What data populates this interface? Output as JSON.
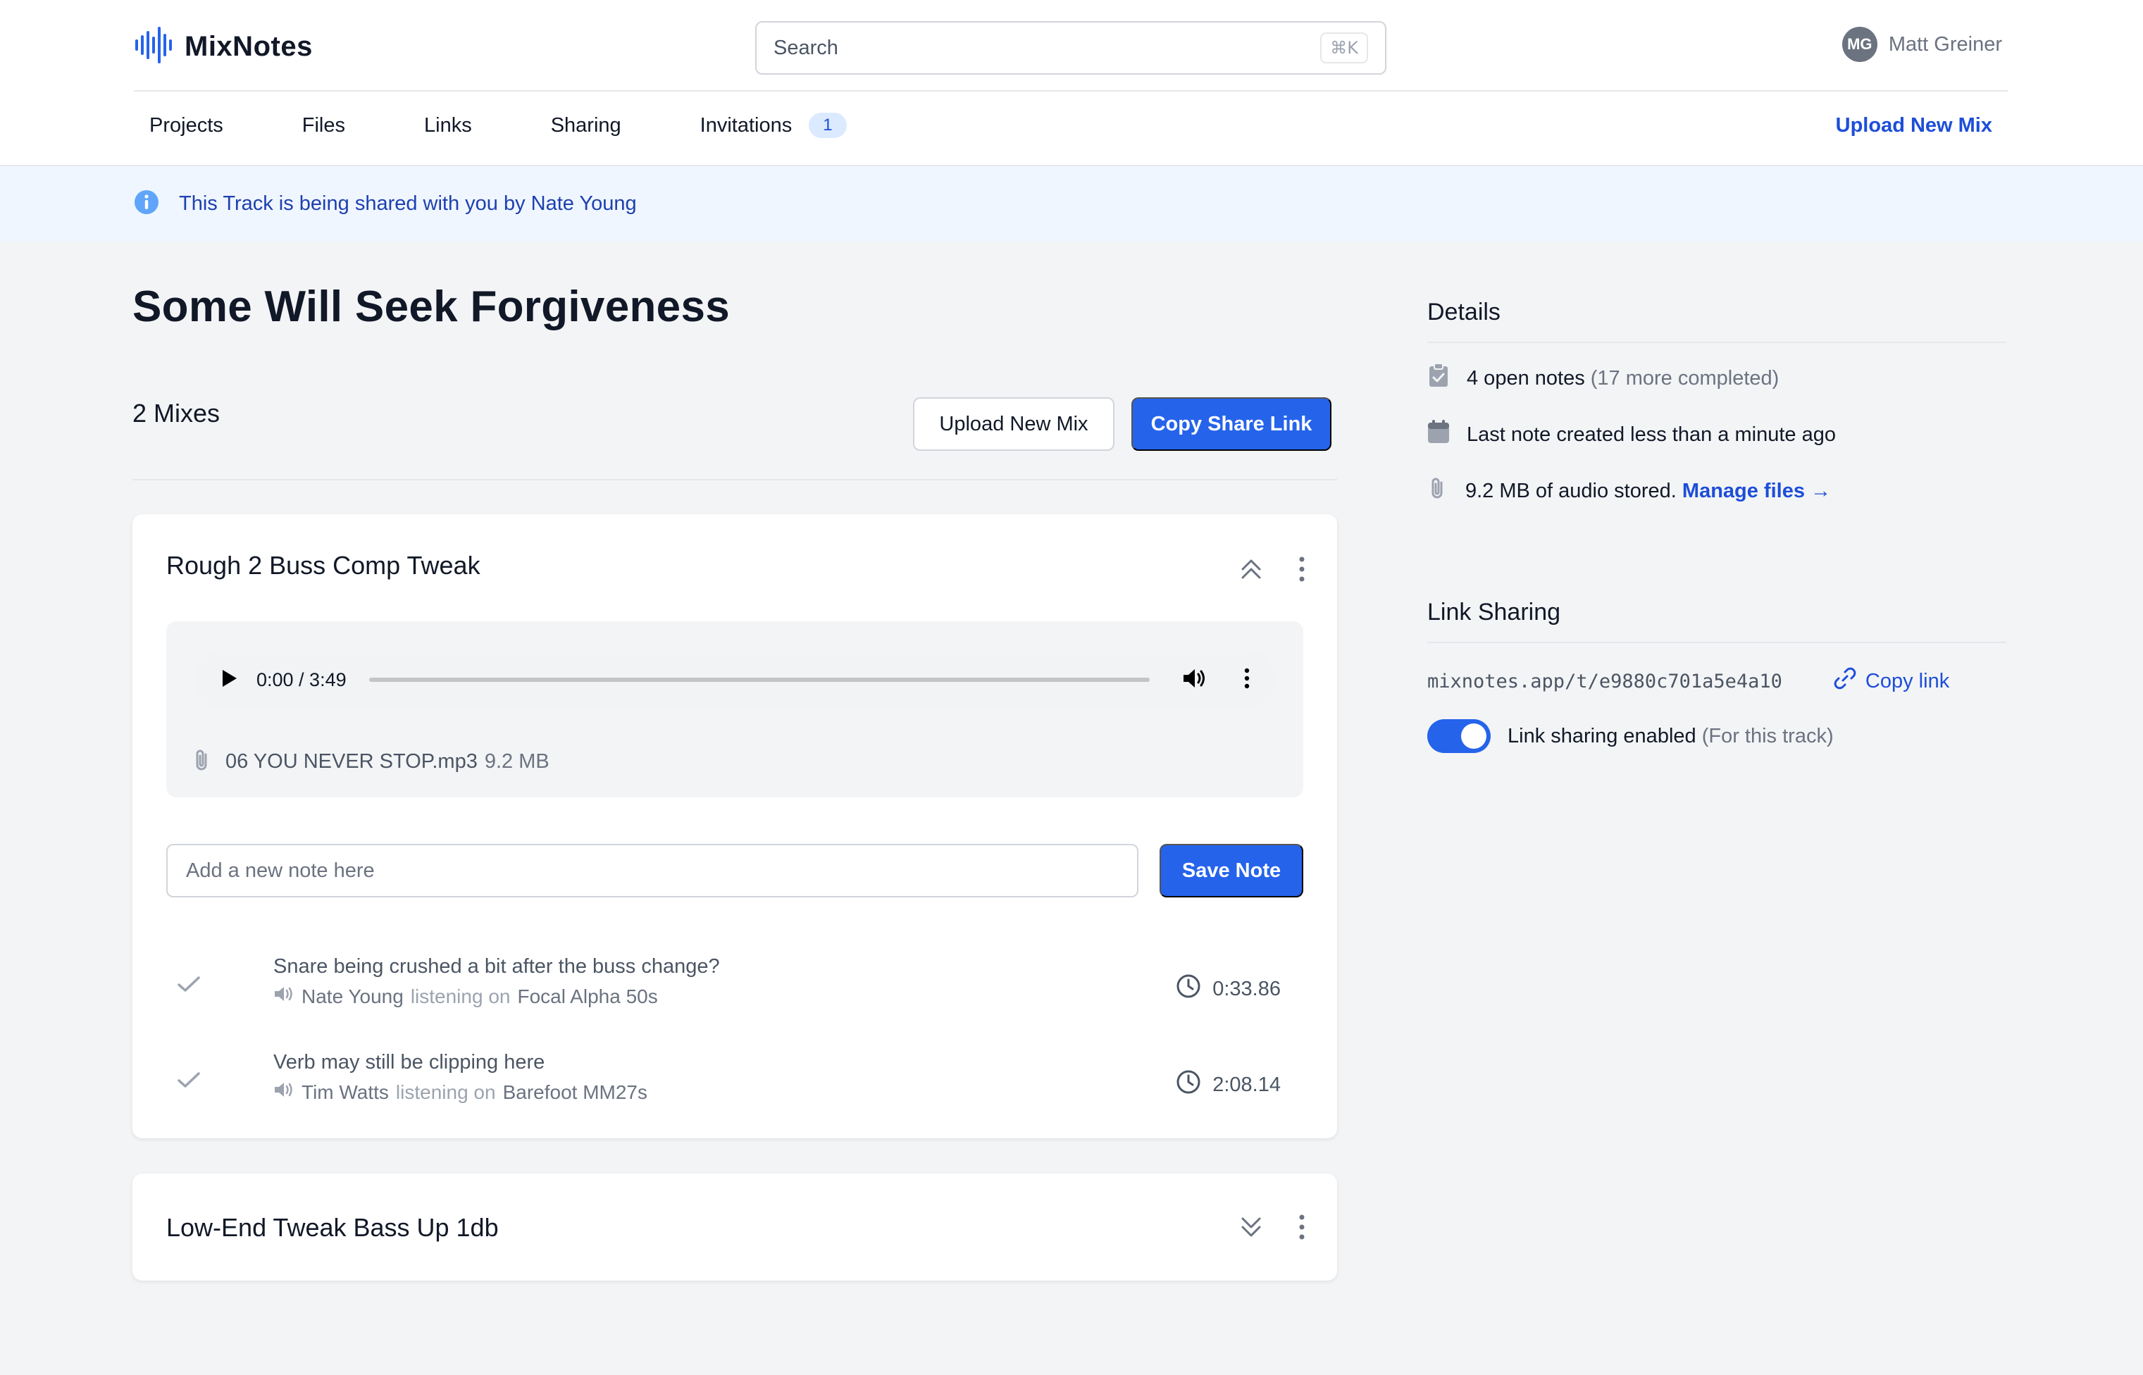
{
  "app": {
    "name": "MixNotes"
  },
  "header": {
    "search_placeholder": "Search",
    "search_shortcut": "⌘K",
    "user": {
      "initials": "MG",
      "name": "Matt Greiner"
    }
  },
  "nav": {
    "items": [
      {
        "label": "Projects"
      },
      {
        "label": "Files"
      },
      {
        "label": "Links"
      },
      {
        "label": "Sharing"
      },
      {
        "label": "Invitations",
        "badge": "1"
      }
    ],
    "upload_label": "Upload New Mix"
  },
  "banner": {
    "text": "This Track is being shared with you by Nate Young"
  },
  "track": {
    "title": "Some Will Seek Forgiveness",
    "mix_count_label": "2 Mixes",
    "upload_button": "Upload New Mix",
    "share_button": "Copy Share Link"
  },
  "mixes": [
    {
      "title": "Rough 2 Buss Comp Tweak",
      "expanded": true,
      "player": {
        "time": "0:00 / 3:49",
        "progress": 0
      },
      "file": {
        "name": "06 YOU NEVER STOP.mp3",
        "size": "9.2 MB"
      },
      "note_placeholder": "Add a new note here",
      "save_label": "Save Note",
      "notes": [
        {
          "text": "Snare being crushed a bit after the buss change?",
          "author": "Nate Young",
          "listening_label": "listening on",
          "device": "Focal Alpha 50s",
          "timestamp": "0:33.86"
        },
        {
          "text": "Verb may still be clipping here",
          "author": "Tim Watts",
          "listening_label": "listening on",
          "device": "Barefoot MM27s",
          "timestamp": "2:08.14"
        }
      ]
    },
    {
      "title": "Low-End Tweak Bass Up 1db",
      "expanded": false
    }
  ],
  "details": {
    "title": "Details",
    "open_notes": "4 open notes",
    "completed": "(17 more completed)",
    "last_note": "Last note created less than a minute ago",
    "storage": "9.2 MB of audio stored.",
    "manage_files": "Manage files →"
  },
  "link_sharing": {
    "title": "Link Sharing",
    "url": "mixnotes.app/t/e9880c701a5e4a10",
    "copy_label": "Copy link",
    "toggle_label": "Link sharing enabled",
    "toggle_scope": "(For this track)",
    "enabled": true
  },
  "colors": {
    "accent": "#2563eb",
    "link": "#1d4ed8",
    "banner_bg": "#eff6ff",
    "page_bg": "#f3f4f6"
  },
  "icons": {
    "logo": "waveform-icon",
    "info": "info-icon",
    "collapse": "chevrons-up-icon",
    "expand": "chevrons-down-icon",
    "more": "more-vertical-icon",
    "attachment": "paperclip-icon",
    "check": "check-icon",
    "speaker": "speaker-icon",
    "clock": "clock-icon",
    "clipboard": "clipboard-check-icon",
    "calendar": "calendar-icon",
    "link": "link-icon"
  }
}
